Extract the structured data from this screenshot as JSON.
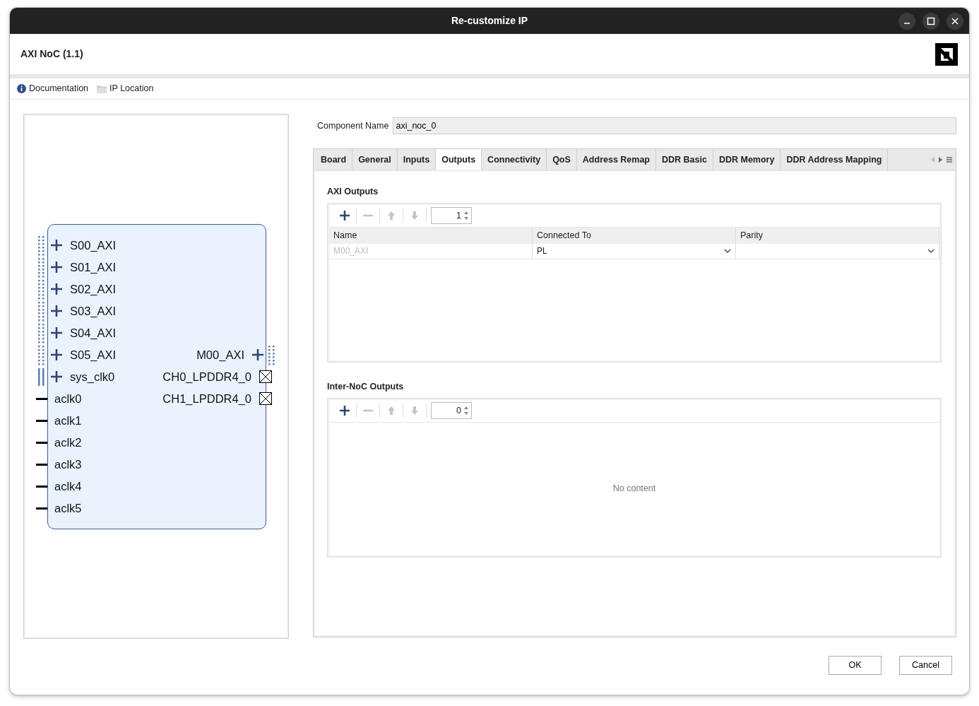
{
  "window": {
    "title": "Re-customize IP"
  },
  "header": {
    "title": "AXI NoC (1.1)"
  },
  "links": [
    {
      "kind": "info",
      "label": "Documentation"
    },
    {
      "kind": "folder",
      "label": "IP Location"
    }
  ],
  "diagram": {
    "rows": [
      {
        "left": {
          "kind": "bus",
          "label": "S00_AXI"
        }
      },
      {
        "left": {
          "kind": "bus",
          "label": "S01_AXI"
        }
      },
      {
        "left": {
          "kind": "bus",
          "label": "S02_AXI"
        }
      },
      {
        "left": {
          "kind": "bus",
          "label": "S03_AXI"
        }
      },
      {
        "left": {
          "kind": "bus",
          "label": "S04_AXI"
        }
      },
      {
        "left": {
          "kind": "bus",
          "label": "S05_AXI"
        },
        "right": {
          "kind": "bus",
          "label": "M00_AXI"
        }
      },
      {
        "left": {
          "kind": "clock",
          "label": "sys_clk0"
        },
        "right": {
          "kind": "unconnected",
          "label": "CH0_LPDDR4_0"
        }
      },
      {
        "left": {
          "kind": "wire",
          "label": "aclk0"
        },
        "right": {
          "kind": "unconnected",
          "label": "CH1_LPDDR4_0"
        }
      },
      {
        "left": {
          "kind": "wire",
          "label": "aclk1"
        }
      },
      {
        "left": {
          "kind": "wire",
          "label": "aclk2"
        }
      },
      {
        "left": {
          "kind": "wire",
          "label": "aclk3"
        }
      },
      {
        "left": {
          "kind": "wire",
          "label": "aclk4"
        }
      },
      {
        "left": {
          "kind": "wire",
          "label": "aclk5"
        }
      }
    ]
  },
  "component_name": {
    "label": "Component Name",
    "value": "axi_noc_0"
  },
  "tabs": [
    {
      "label": "Board",
      "selected": false
    },
    {
      "label": "General",
      "selected": false
    },
    {
      "label": "Inputs",
      "selected": false
    },
    {
      "label": "Outputs",
      "selected": true
    },
    {
      "label": "Connectivity",
      "selected": false
    },
    {
      "label": "QoS",
      "selected": false
    },
    {
      "label": "Address Remap",
      "selected": false
    },
    {
      "label": "DDR Basic",
      "selected": false
    },
    {
      "label": "DDR Memory",
      "selected": false
    },
    {
      "label": "DDR Address Mapping",
      "selected": false
    }
  ],
  "sections": [
    {
      "title": "AXI Outputs",
      "tools": [
        {
          "kind": "add",
          "disabled": false
        },
        {
          "kind": "remove",
          "disabled": true
        },
        {
          "kind": "up",
          "disabled": true
        },
        {
          "kind": "down",
          "disabled": true
        }
      ],
      "count": "1",
      "columns": [
        "Name",
        "Connected To",
        "Parity"
      ],
      "rows": [
        [
          {
            "kind": "text",
            "text": "M00_AXI",
            "disabled": true
          },
          {
            "kind": "select",
            "text": "PL"
          },
          {
            "kind": "select"
          }
        ]
      ]
    },
    {
      "title": "Inter-NoC Outputs",
      "tools": [
        {
          "kind": "add",
          "disabled": false
        },
        {
          "kind": "remove",
          "disabled": true
        },
        {
          "kind": "up",
          "disabled": true
        },
        {
          "kind": "down",
          "disabled": true
        }
      ],
      "count": "0",
      "empty_text": "No content"
    }
  ],
  "buttons": [
    "OK",
    "Cancel"
  ]
}
